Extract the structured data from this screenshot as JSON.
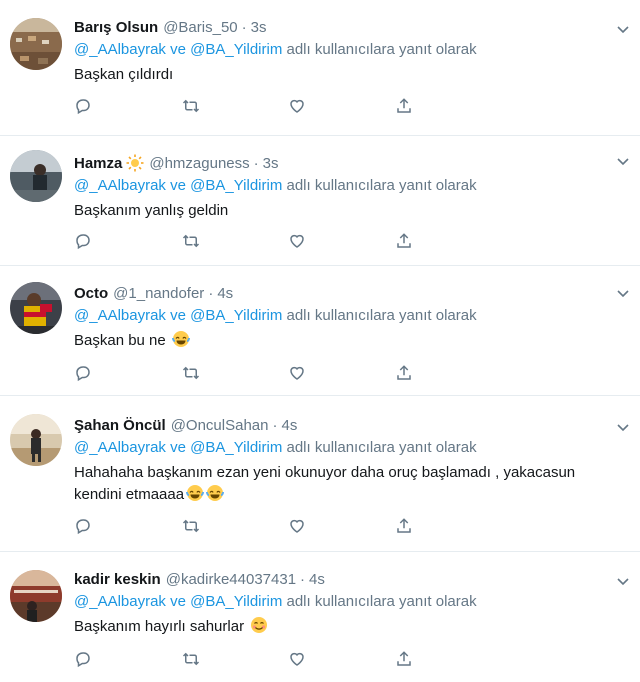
{
  "colors": {
    "link": "#1b95e0",
    "muted": "#657786",
    "text": "#14171a",
    "divider": "#e6ecf0"
  },
  "reply_template": {
    "mention1": "@_AAlbayrak",
    "connector": "ve",
    "mention2": "@BA_Yildirim",
    "suffix": "adlı kullanıcılara yanıt olarak"
  },
  "actions": [
    "reply-icon",
    "retweet-icon",
    "like-icon",
    "share-icon"
  ],
  "tweets": [
    {
      "name": "Barış Olsun",
      "handle": "@Baris_50",
      "time": "3s",
      "text": "Başkan çıldırdı",
      "text_emoji": "",
      "name_badge": ""
    },
    {
      "name": "Hamza",
      "handle": "@hmzaguness",
      "time": "3s",
      "text": "Başkanım yanlış geldin",
      "text_emoji": "",
      "name_badge": "sun-emoji"
    },
    {
      "name": "Octo",
      "handle": "@1_nandofer",
      "time": "4s",
      "text": "Başkan bu ne",
      "text_emoji": "laughing-tears-emoji",
      "name_badge": ""
    },
    {
      "name": "Şahan Öncül",
      "handle": "@OnculSahan",
      "time": "4s",
      "text": "Hahahaha başkanım ezan yeni okunuyor daha oruç başlamadı , yakacasun kendini etmaaaa",
      "text_emoji": "laughing-tears-emoji-x2",
      "name_badge": ""
    },
    {
      "name": "kadir keskin",
      "handle": "@kadirke44037431",
      "time": "4s",
      "text": "Başkanım hayırlı sahurlar",
      "text_emoji": "smiling-emoji",
      "name_badge": ""
    }
  ]
}
